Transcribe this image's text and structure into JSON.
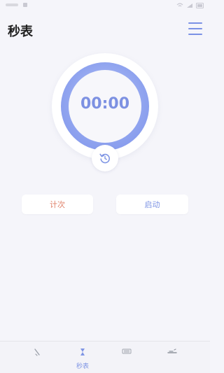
{
  "header": {
    "title": "秒表"
  },
  "stopwatch": {
    "time": "00:00"
  },
  "controls": {
    "lap_label": "计次",
    "start_label": "启动"
  },
  "bottom_nav": {
    "items": [
      {
        "icon": "alarm-icon",
        "label": ""
      },
      {
        "icon": "hourglass-icon",
        "label": "秒表"
      },
      {
        "icon": "keyboard-icon",
        "label": ""
      },
      {
        "icon": "bed-icon",
        "label": ""
      }
    ],
    "active_index": 1
  },
  "colors": {
    "accent": "#7f95e4",
    "lap": "#e0826a",
    "background": "#f5f5fa"
  }
}
